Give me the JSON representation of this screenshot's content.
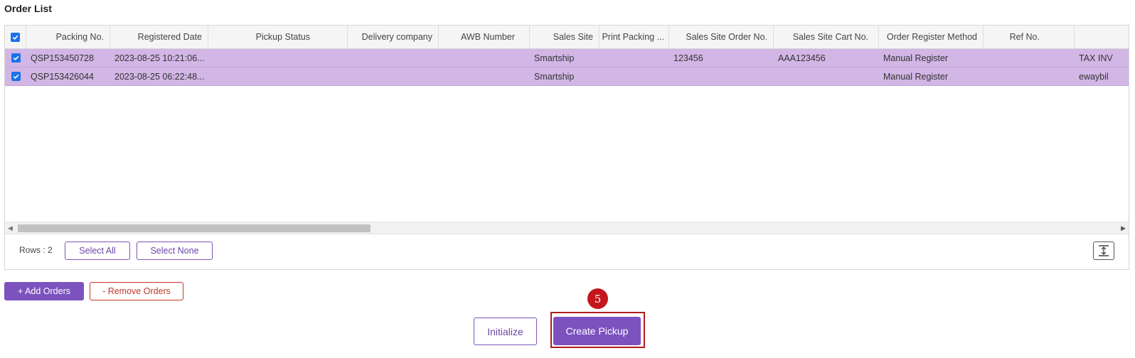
{
  "section": {
    "title": "Order List"
  },
  "grid": {
    "columns": [
      "Packing No.",
      "Registered Date",
      "Pickup Status",
      "Delivery company",
      "AWB Number",
      "Sales Site",
      "Print Packing ...",
      "Sales Site Order No.",
      "Sales Site Cart No.",
      "Order Register Method",
      "Ref No.",
      ""
    ],
    "rows": [
      {
        "checked": true,
        "cells": [
          "QSP153450728",
          "2023-08-25 10:21:06...",
          "",
          "",
          "",
          "Smartship",
          "",
          "123456",
          "AAA123456",
          "Manual Register",
          "",
          "TAX INV"
        ]
      },
      {
        "checked": true,
        "cells": [
          "QSP153426044",
          "2023-08-25 06:22:48...",
          "",
          "",
          "",
          "Smartship",
          "",
          "",
          "",
          "Manual Register",
          "",
          "ewaybil"
        ]
      }
    ],
    "rows_count": "Rows : 2",
    "select_all": "Select All",
    "select_none": "Select None"
  },
  "actions": {
    "add_orders": "+ Add Orders",
    "remove_orders": "- Remove Orders",
    "initialize": "Initialize",
    "create_pickup": "Create Pickup",
    "step_number": "5"
  },
  "colors": {
    "primary": "#7c52bf",
    "selected_row": "#d2b6e6",
    "danger": "#c0392b",
    "badge": "#c4161c"
  }
}
